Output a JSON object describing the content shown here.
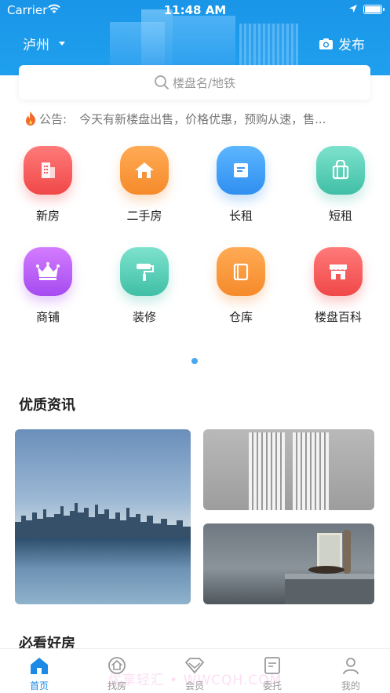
{
  "status_bar": {
    "carrier": "Carrier",
    "time": "11:48 AM"
  },
  "header": {
    "city": "泸州",
    "publish_label": "发布"
  },
  "search": {
    "placeholder": "楼盘名/地铁"
  },
  "notice": {
    "label": "公告:",
    "text": "今天有新楼盘出售，价格优惠，预购从速，售..."
  },
  "categories": [
    {
      "label": "新房",
      "icon": "building-icon",
      "color": "#f04848"
    },
    {
      "label": "二手房",
      "icon": "house-icon",
      "color": "#f58a2a"
    },
    {
      "label": "长租",
      "icon": "document-icon",
      "color": "#2f8ff0"
    },
    {
      "label": "短租",
      "icon": "bag-icon",
      "color": "#40bfa6"
    },
    {
      "label": "商铺",
      "icon": "crown-icon",
      "color": "#a64bf0"
    },
    {
      "label": "装修",
      "icon": "paint-roller-icon",
      "color": "#40bfa6"
    },
    {
      "label": "仓库",
      "icon": "book-icon",
      "color": "#f58a2a"
    },
    {
      "label": "楼盘百科",
      "icon": "store-icon",
      "color": "#f04848"
    }
  ],
  "sections": {
    "news_title": "优质资讯",
    "recommend_title": "必看好房"
  },
  "tabs": [
    {
      "label": "首页",
      "icon": "home-icon",
      "active": true
    },
    {
      "label": "找房",
      "icon": "find-house-icon",
      "active": false
    },
    {
      "label": "会员",
      "icon": "diamond-icon",
      "active": false
    },
    {
      "label": "委托",
      "icon": "entrust-icon",
      "active": false
    },
    {
      "label": "我的",
      "icon": "user-icon",
      "active": false
    }
  ],
  "watermark": "优享轻汇 • WWCQH.COM",
  "colors": {
    "primary": "#1a95e8",
    "tab_active": "#1a8ae6"
  }
}
